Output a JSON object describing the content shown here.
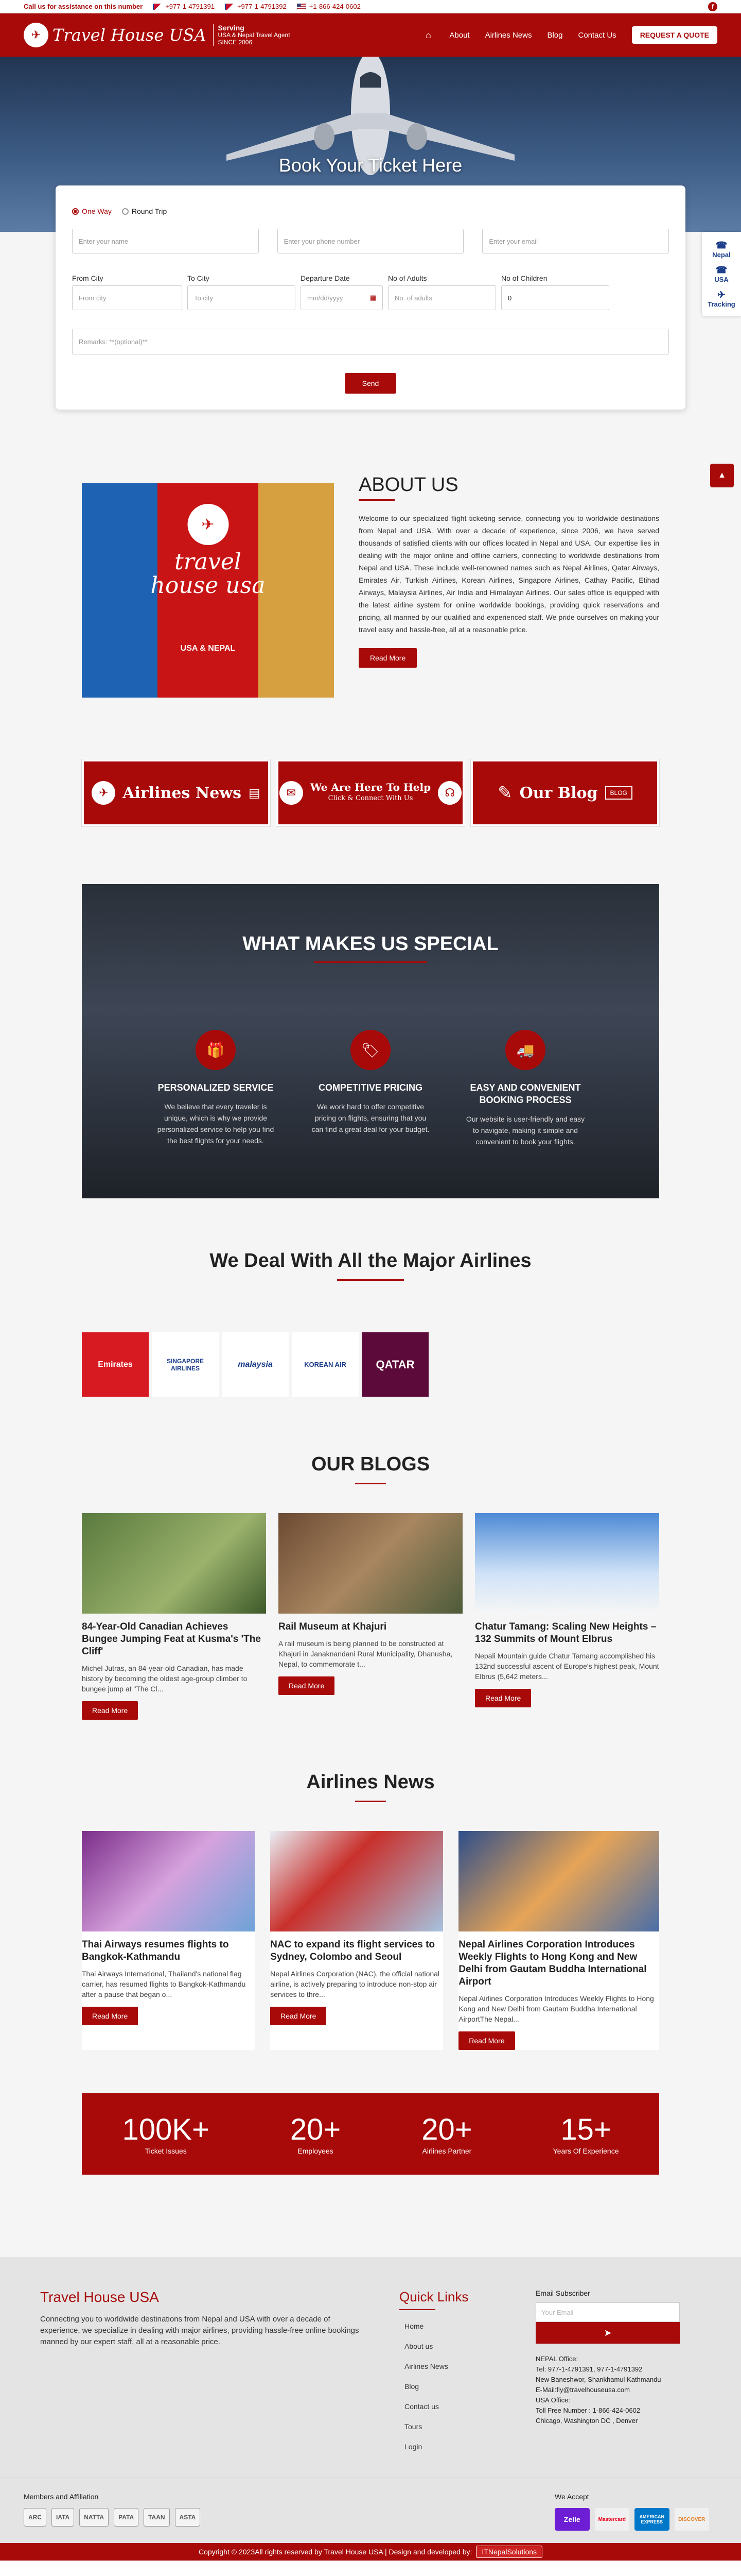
{
  "topbar": {
    "message": "Call us for assistance on this number",
    "phones": [
      "+977-1-4791391",
      "+977-1-4791392",
      "+1-866-424-0602"
    ]
  },
  "nav": {
    "logo_text": "Travel House USA",
    "serving_line1": "Serving",
    "serving_line2": "USA & Nepal Travel Agent",
    "serving_line3": "SINCE 2006",
    "links": [
      "About",
      "Airlines News",
      "Blog",
      "Contact Us"
    ],
    "quote_button": "REQUEST A QUOTE"
  },
  "hero": {
    "title": "Book Your Ticket Here"
  },
  "booking_form": {
    "trip_types": [
      "One Way",
      "Round Trip"
    ],
    "selected_trip": "One Way",
    "name_placeholder": "Enter your name",
    "phone_placeholder": "Enter your phone number",
    "email_placeholder": "Enter your email",
    "from_label": "From City",
    "from_placeholder": "From city",
    "to_label": "To City",
    "to_placeholder": "To city",
    "date_label": "Departure Date",
    "date_placeholder": "mm/dd/yyyy",
    "adults_label": "No of Adults",
    "adults_placeholder": "No. of adults",
    "children_label": "No of Children",
    "children_value": "0",
    "remarks_placeholder": "Remarks: **(optional)**",
    "send_button": "Send"
  },
  "side_widget": [
    "Nepal",
    "USA",
    "Tracking"
  ],
  "about": {
    "title": "ABOUT US",
    "image_title": "travel house usa",
    "image_sub": "USA & NEPAL",
    "body": "Welcome to our specialized flight ticketing service, connecting you to worldwide destinations from Nepal and USA. With over a decade of experience, since 2006, we have served thousands of satisfied clients with our offices located in Nepal and USA. Our expertise lies in dealing with the major online and offline carriers, connecting to worldwide destinations from Nepal and USA. These include well-renowned names such as Nepal Airlines, Qatar Airways, Emirates Air, Turkish Airlines, Korean Airlines, Singapore Airlines, Cathay Pacific, Etihad Airways, Malaysia Airlines, Air India and Himalayan Airlines. Our sales office is equipped with the latest airline system for online worldwide bookings, providing quick reservations and pricing, all manned by our qualified and experienced staff. We pride ourselves on making your travel easy and hassle-free, all at a reasonable price.",
    "button": "Read More"
  },
  "banners": {
    "news": "Airlines News",
    "help_title": "We Are Here To Help",
    "help_sub": "Click & Connect With Us",
    "blog": "Our Blog",
    "blog_tag": "BLOG"
  },
  "special": {
    "title": "WHAT MAKES US SPECIAL",
    "items": [
      {
        "title": "PERSONALIZED SERVICE",
        "text": "We believe that every traveler is unique, which is why we provide personalized service to help you find the best flights for your needs."
      },
      {
        "title": "COMPETITIVE PRICING",
        "text": "We work hard to offer competitive pricing on flights, ensuring that you can find a great deal for your budget."
      },
      {
        "title": "EASY AND CONVENIENT BOOKING PROCESS",
        "text": "Our website is user-friendly and easy to navigate, making it simple and convenient to book your flights."
      }
    ]
  },
  "partners": {
    "title": "We Deal With All the Major Airlines",
    "logos": [
      "Emirates",
      "SINGAPORE AIRLINES",
      "malaysia",
      "KOREAN AIR",
      "QATAR"
    ]
  },
  "blogs": {
    "title": "OUR BLOGS",
    "items": [
      {
        "title": "84-Year-Old Canadian Achieves Bungee Jumping Feat at Kusma's 'The Cliff'",
        "excerpt": " Michel Jutras, an 84-year-old Canadian, has made history by becoming the oldest age-group climber to bungee jump at \"The Cl...",
        "button": "Read More"
      },
      {
        "title": "Rail Museum at Khajuri",
        "excerpt": "A rail museum is being planned to be constructed at Khajuri in Janaknandani Rural Municipality, Dhanusha, Nepal, to commemorate t...",
        "button": "Read More"
      },
      {
        "title": "Chatur Tamang: Scaling New Heights – 132 Summits of Mount Elbrus",
        "excerpt": "Nepali Mountain guide Chatur Tamang accomplished his 132nd successful ascent of Europe's highest peak, Mount Elbrus (5,642 meters...",
        "button": "Read More"
      }
    ]
  },
  "news": {
    "title": "Airlines News",
    "items": [
      {
        "title": "Thai Airways resumes flights to Bangkok-Kathmandu",
        "excerpt": "Thai Airways International, Thailand's national flag carrier, has resumed flights to Bangkok-Kathmandu after a pause that began o...",
        "button": "Read More"
      },
      {
        "title": "NAC to expand its flight services to Sydney, Colombo and Seoul",
        "excerpt": "Nepal Airlines Corporation (NAC), the official national airline, is actively preparing to introduce non-stop air services to thre...",
        "button": "Read More"
      },
      {
        "title": "Nepal Airlines Corporation Introduces Weekly Flights to Hong Kong and New Delhi from Gautam Buddha International Airport",
        "excerpt": "Nepal Airlines Corporation Introduces Weekly Flights to Hong Kong and New Delhi from Gautam Buddha International AirportThe Nepal...",
        "button": "Read More"
      }
    ]
  },
  "stats": [
    {
      "number": "100K+",
      "label": "Ticket Issues"
    },
    {
      "number": "20+",
      "label": "Employees"
    },
    {
      "number": "20+",
      "label": "Airlines Partner"
    },
    {
      "number": "15+",
      "label": "Years Of Experience"
    }
  ],
  "footer": {
    "title": "Travel House USA",
    "about": "Connecting you to worldwide destinations from Nepal and USA with over a decade of experience, we specialize in dealing with major airlines, providing hassle-free online bookings manned by our expert staff, all at a reasonable price.",
    "quick_links_title": "Quick Links",
    "quick_links": [
      "Home",
      "About us",
      "Airlines News",
      "Blog",
      "Contact us",
      "Tours",
      "Login"
    ],
    "subscriber_title": "Email Subscriber",
    "email_placeholder": "Your Email",
    "nepal_office_label": "NEPAL Office:",
    "nepal_phone": "Tel: 977-1-4791391, 977-1-4791392",
    "nepal_address": "New Baneshwor, Shankhamul Kathmandu",
    "nepal_email": "E-Mail:fly@travelhouseusa.com",
    "usa_office_label": "USA Office:",
    "usa_phone": "Toll Free Number : 1-866-424-0602",
    "usa_address": "Chicago, Washington DC , Denver"
  },
  "membership": {
    "title": "Members and Affiliation",
    "logos": [
      "ARC",
      "IATA",
      "NATTA",
      "PATA",
      "TAAN",
      "ASTA"
    ]
  },
  "payments": {
    "title": "We Accept",
    "methods": [
      "Zelle",
      "Mastercard",
      "AMERICAN EXPRESS",
      "DISCOVER"
    ],
    "colors": [
      "#6d1ed4",
      "#f0f0f0",
      "#0077c8",
      "#f0f0f0"
    ]
  },
  "copyright": {
    "text": "Copyright © 2023All rights reserved by Travel House USA | Design and developed by:",
    "developer": "ITNepalSolutions"
  },
  "colors": {
    "brand": "#a80a0a"
  }
}
